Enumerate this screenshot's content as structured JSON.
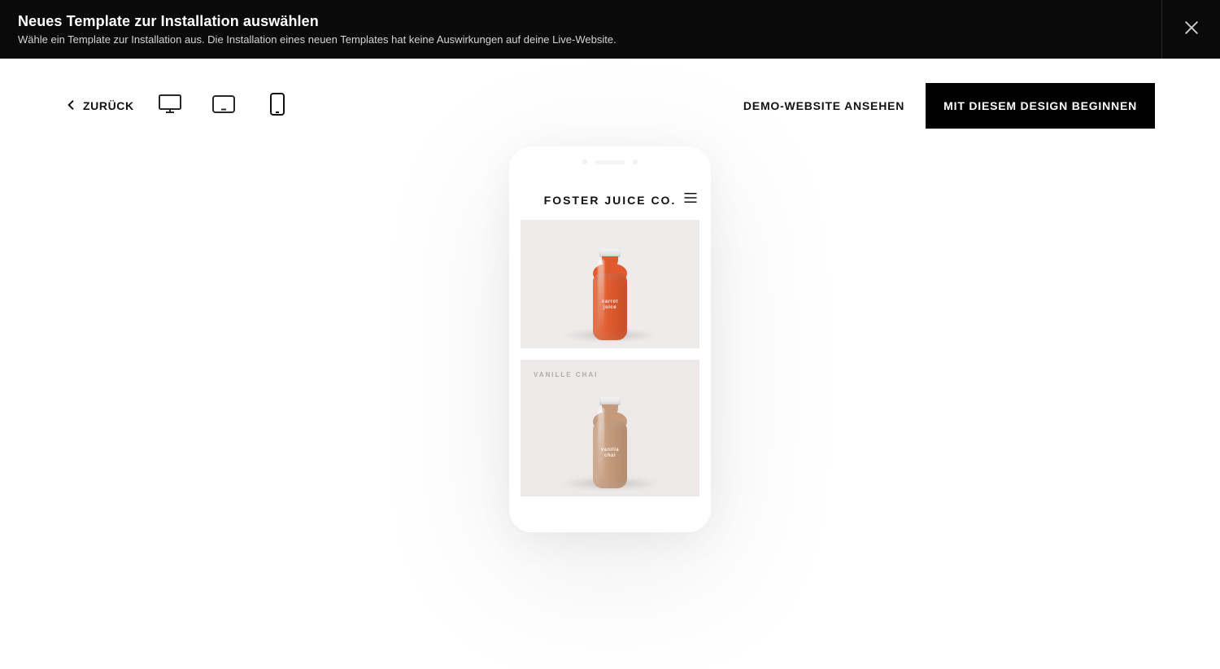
{
  "topbar": {
    "title": "Neues Template zur Installation auswählen",
    "subtitle": "Wähle ein Template zur Installation aus. Die Installation eines neuen Templates hat keine Auswirkungen auf deine Live-Website."
  },
  "toolbar": {
    "back_label": "ZURÜCK",
    "demo_label": "DEMO-WEBSITE ANSEHEN",
    "cta_label": "MIT DIESEM DESIGN BEGINNEN",
    "devices": {
      "desktop": "desktop",
      "tablet": "tablet",
      "phone": "phone",
      "active": "phone"
    }
  },
  "preview": {
    "brand": "FOSTER JUICE CO.",
    "products": [
      {
        "label": "",
        "bottle_text": "carrot\njuice",
        "color": "orange"
      },
      {
        "label": "VANILLE CHAI",
        "bottle_text": "vanilla\nchai",
        "color": "brown"
      }
    ]
  },
  "icons": {
    "close": "close-icon",
    "chevron_left": "chevron-left-icon",
    "menu": "menu-icon",
    "desktop": "desktop-icon",
    "tablet": "tablet-icon",
    "phone": "phone-icon"
  }
}
